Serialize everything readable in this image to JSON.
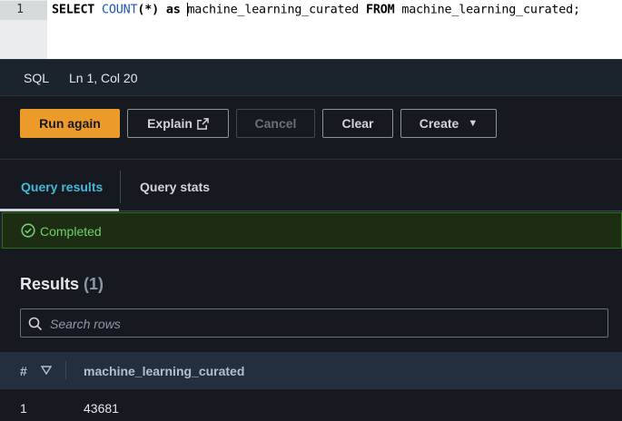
{
  "editor": {
    "line_number": "1",
    "tokens": {
      "select": "SELECT",
      "count_fn": "COUNT",
      "count_args": "(*)",
      "as": "as",
      "alias": "machine_learning_curated",
      "from": "FROM",
      "table": "machine_learning_curated;"
    }
  },
  "status": {
    "language": "SQL",
    "position": "Ln 1, Col 20"
  },
  "toolbar": {
    "run_again": "Run again",
    "explain": "Explain",
    "cancel": "Cancel",
    "clear": "Clear",
    "create": "Create"
  },
  "tabs": {
    "query_results": "Query results",
    "query_stats": "Query stats"
  },
  "banner": {
    "status": "Completed"
  },
  "results": {
    "title": "Results",
    "count": "(1)",
    "search_placeholder": "Search rows",
    "columns": {
      "index": "#",
      "col1": "machine_learning_curated"
    },
    "rows": [
      {
        "index": "1",
        "value": "43681"
      }
    ]
  },
  "colors": {
    "primary_button": "#ec9a29",
    "active_tab": "#44b9d6",
    "success": "#6fcf6f"
  }
}
